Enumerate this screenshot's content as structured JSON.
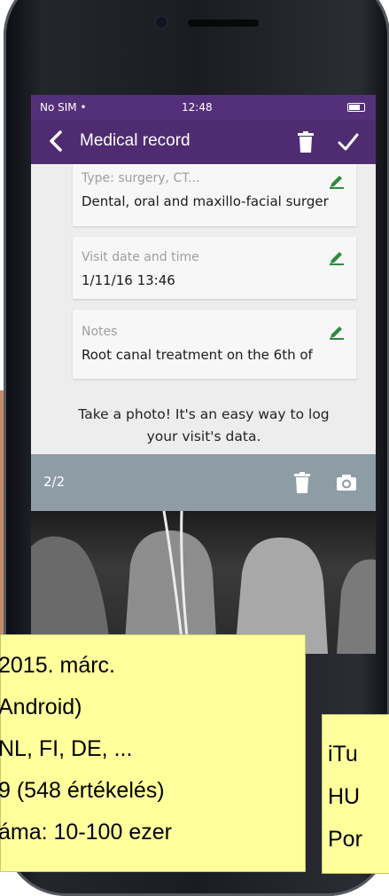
{
  "status_bar": {
    "carrier": "No SIM •",
    "time": "12:48"
  },
  "toolbar": {
    "title": "Medical record"
  },
  "fields": [
    {
      "label": "Type: surgery, CT...",
      "value": "Dental, oral and maxillo-facial surger"
    },
    {
      "label": "Visit date and time",
      "value": "1/11/16 13:46"
    },
    {
      "label": "Notes",
      "value": "Root canal treatment on the  6th of"
    }
  ],
  "hint": {
    "line1": "Take a photo! It's an easy way to log",
    "line2": "your visit's data."
  },
  "photo_bar": {
    "counter": "2/2"
  },
  "overlay_left": {
    "lines": [
      "2015. márc.",
      "Android)",
      "NL, FI, DE, ...",
      "9 (548 értékelés)",
      "áma: 10-100 ezer"
    ]
  },
  "overlay_right": {
    "lines": [
      "iTu",
      "HU",
      "Por"
    ]
  },
  "colors": {
    "statusbar": "#55307a",
    "toolbar": "#4f2c72",
    "accent_edit": "#2e8b3e",
    "note_bg": "#ffff9c"
  },
  "icons": [
    "back-chevron-icon",
    "trash-icon",
    "check-icon",
    "pencil-icon",
    "camera-icon"
  ]
}
